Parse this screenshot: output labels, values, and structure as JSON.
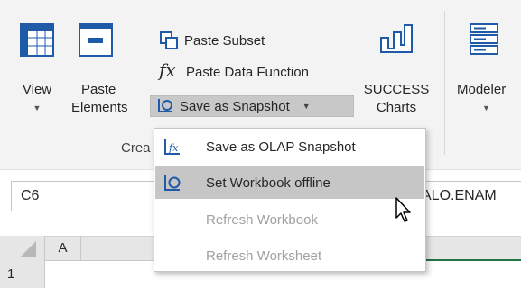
{
  "ribbon": {
    "view_label": "View",
    "paste_elements_label_1": "Paste",
    "paste_elements_label_2": "Elements",
    "paste_subset_label": "Paste Subset",
    "paste_data_function_label": "Paste Data Function",
    "save_as_snapshot_label": "Save as Snapshot",
    "success_charts_label_1": "SUCCESS",
    "success_charts_label_2": "Charts",
    "modeler_label": "Modeler",
    "group_label_fragment": "Crea",
    "fx_glyph": "fx"
  },
  "formula_bar": {
    "name_box_value": "C6",
    "formula_fragment": "ALO.ENAM"
  },
  "grid": {
    "column_a": "A",
    "row_1": "1"
  },
  "snapshot_menu": {
    "items": [
      {
        "label": "Save as OLAP Snapshot",
        "enabled": true
      },
      {
        "label": "Set Workbook offline",
        "enabled": true,
        "highlighted": true
      },
      {
        "label": "Refresh Workbook",
        "enabled": false
      },
      {
        "label": "Refresh Worksheet",
        "enabled": false
      }
    ]
  },
  "colors": {
    "accent_blue": "#1e5aa8",
    "excel_green": "#217346",
    "ribbon_bg": "#f3f3f3",
    "hover_gray": "#c6c6c6"
  }
}
